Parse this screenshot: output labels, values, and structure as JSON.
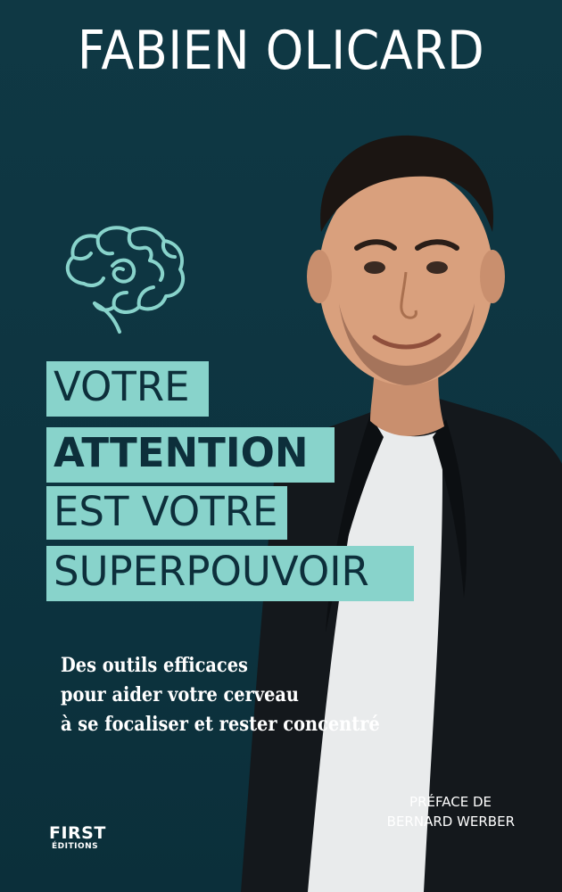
{
  "cover": {
    "author": "FABIEN OLICARD",
    "title_lines": [
      "VOTRE",
      "ATTENTION",
      "EST VOTRE",
      "SUPERPOUVOIR"
    ],
    "subtitle_lines": [
      "Des outils efficaces",
      "pour aider votre cerveau",
      "à se focaliser et rester concentré"
    ],
    "preface_lines": [
      "PRÉFACE DE",
      "BERNARD WERBER"
    ],
    "publisher": {
      "name": "FIRST",
      "sub": "ÉDITIONS"
    },
    "icons": {
      "brain": "brain-icon"
    },
    "colors": {
      "background": "#0f3844",
      "title_highlight": "#88d3cb",
      "title_text": "#0d2f3b",
      "text": "#ffffff"
    }
  }
}
